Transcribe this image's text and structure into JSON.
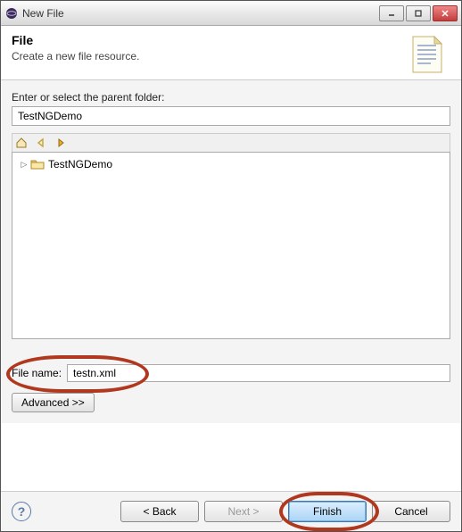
{
  "window": {
    "title": "New File"
  },
  "header": {
    "title": "File",
    "description": "Create a new file resource."
  },
  "parent": {
    "label": "Enter or select the parent folder:",
    "value": "TestNGDemo"
  },
  "tree": {
    "items": [
      {
        "label": "TestNGDemo",
        "icon": "folder-icon"
      }
    ]
  },
  "filename": {
    "label": "File name:",
    "value": "testn.xml"
  },
  "advanced": {
    "label": "Advanced >>"
  },
  "buttons": {
    "back": "< Back",
    "next": "Next >",
    "finish": "Finish",
    "cancel": "Cancel"
  }
}
